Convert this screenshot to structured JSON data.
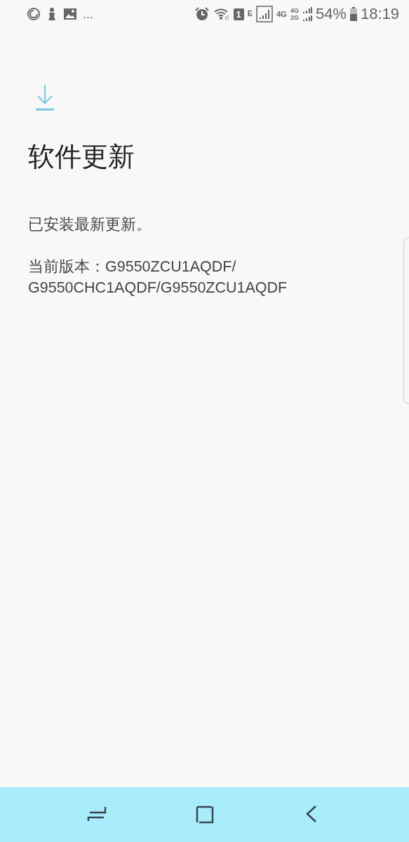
{
  "status_bar": {
    "more": "...",
    "sim_slot": "1",
    "network_type": "E",
    "signal_1": "4G",
    "signal_2_top": "4G",
    "signal_2_bottom": "2G",
    "battery": "54%",
    "time": "18:19"
  },
  "page": {
    "title": "软件更新",
    "message": "已安装最新更新。",
    "version_lines": [
      "当前版本：G9550ZCU1AQDF/",
      "G9550CHC1AQDF/G9550ZCU1AQDF"
    ]
  },
  "nav_bar": {
    "buttons": [
      {
        "kind": "recents"
      },
      {
        "kind": "home"
      },
      {
        "kind": "back"
      }
    ]
  }
}
